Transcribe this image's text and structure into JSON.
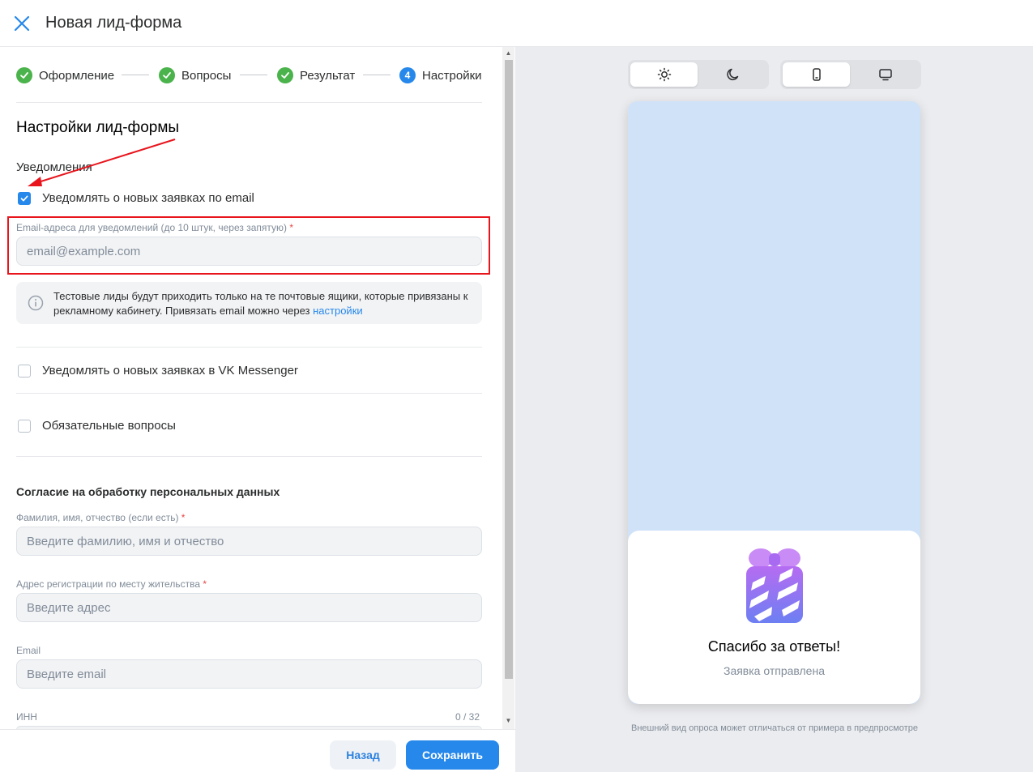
{
  "header": {
    "title": "Новая лид-форма"
  },
  "steps": [
    {
      "label": "Оформление",
      "state": "done"
    },
    {
      "label": "Вопросы",
      "state": "done"
    },
    {
      "label": "Результат",
      "state": "done"
    },
    {
      "label": "Настройки",
      "state": "current",
      "number": "4"
    }
  ],
  "settings": {
    "title": "Настройки лид-формы",
    "notifications_title": "Уведомления",
    "email_checkbox": {
      "label": "Уведомлять о новых заявках по email",
      "checked": true
    },
    "email_field": {
      "label": "Email-адреса для уведомлений (до 10 штук, через запятую)",
      "required_mark": "*",
      "placeholder": "email@example.com"
    },
    "info": {
      "text": "Тестовые лиды будут приходить только на те почтовые ящики, которые привязаны к рекламному кабинету. Привязать email можно через ",
      "link": "настройки"
    },
    "vk_checkbox": {
      "label": "Уведомлять о новых заявках в VK Messenger",
      "checked": false
    },
    "required_checkbox": {
      "label": "Обязательные вопросы",
      "checked": false
    }
  },
  "consent": {
    "title": "Согласие на обработку персональных данных",
    "fio": {
      "label": "Фамилия, имя, отчество (если есть)",
      "required_mark": "*",
      "placeholder": "Введите фамилию, имя и отчество"
    },
    "address": {
      "label": "Адрес регистрации по месту жительства",
      "required_mark": "*",
      "placeholder": "Введите адрес"
    },
    "email": {
      "label": "Email",
      "placeholder": "Введите email"
    },
    "inn": {
      "label": "ИНН",
      "counter": "0 / 32"
    }
  },
  "buttons": {
    "back": "Назад",
    "save": "Сохранить"
  },
  "preview": {
    "theme_options": [
      "light-theme-icon",
      "dark-theme-icon"
    ],
    "theme_selected": "light",
    "device_options": [
      "mobile-icon",
      "desktop-icon"
    ],
    "device_selected": "mobile",
    "thanks_title": "Спасибо за ответы!",
    "thanks_subtitle": "Заявка отправлена",
    "note": "Внешний вид опроса может отличаться от примера в предпросмотре"
  },
  "colors": {
    "accent": "#2688eb",
    "success": "#4bb34b",
    "highlight": "#e8151d",
    "preview_bg": "#cfe2f8"
  }
}
